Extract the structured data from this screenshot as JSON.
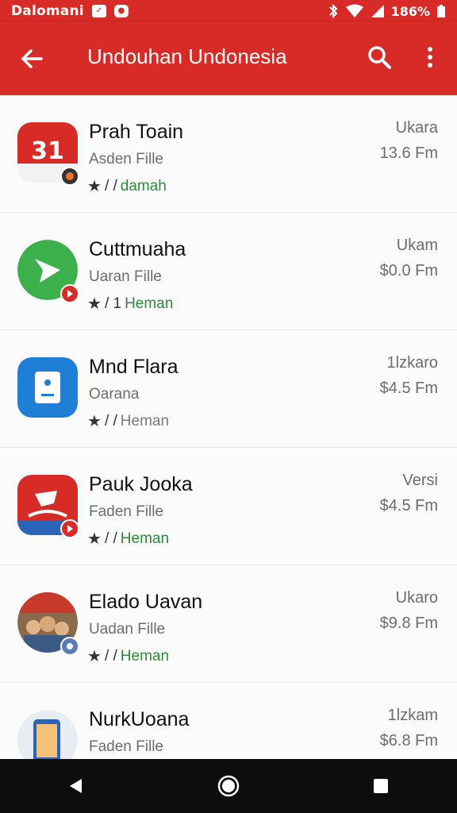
{
  "status_bar": {
    "carrier": "Dalomani",
    "battery_text": "186%"
  },
  "app_bar": {
    "title": "Undouhan Undonesia",
    "back_icon": "arrow-back-icon",
    "search_icon": "search-icon",
    "menu_icon": "more-vert-icon",
    "color": "#d62b26"
  },
  "items": [
    {
      "name": "Prah Toain",
      "subtitle": "Asden Fille",
      "meta_prefix": "/ /",
      "status": "damah",
      "status_color": "green",
      "version": "Ukara",
      "size": "13.6 Fm",
      "icon_text": "31",
      "icon_color": "#d62b26"
    },
    {
      "name": "Cuttmuaha",
      "subtitle": "Uaran Fille",
      "meta_prefix": "/ 1",
      "status": "Heman",
      "status_color": "green",
      "version": "Ukam",
      "size": "$0.0 Fm",
      "icon_color": "#3cb04a"
    },
    {
      "name": "Mnd Flara",
      "subtitle": "Oarana",
      "meta_prefix": "/ /",
      "status": "Heman",
      "status_color": "grey",
      "version": "1lzkaro",
      "size": "$4.5 Fm",
      "icon_color": "#1f7fd6"
    },
    {
      "name": "Pauk Jooka",
      "subtitle": "Faden Fille",
      "meta_prefix": "/ /",
      "status": "Heman",
      "status_color": "green",
      "version": "Versi",
      "size": "$4.5 Fm",
      "icon_color": "#d62b26"
    },
    {
      "name": "Elado Uavan",
      "subtitle": "Uadan Fille",
      "meta_prefix": "/ /",
      "status": "Heman",
      "status_color": "green",
      "version": "Ukaro",
      "size": "$9.8 Fm",
      "icon_color": "#6c8a4a"
    },
    {
      "name": "NurkUoana",
      "subtitle": "Faden Fille",
      "meta_prefix": "",
      "status": "",
      "status_color": "green",
      "version": "1lzkam",
      "size": "$6.8 Fm",
      "icon_color": "#2a63b8"
    }
  ],
  "nav_bar": {
    "back_icon": "triangle-back-icon",
    "home_icon": "circle-home-icon",
    "recents_icon": "square-recents-icon"
  }
}
